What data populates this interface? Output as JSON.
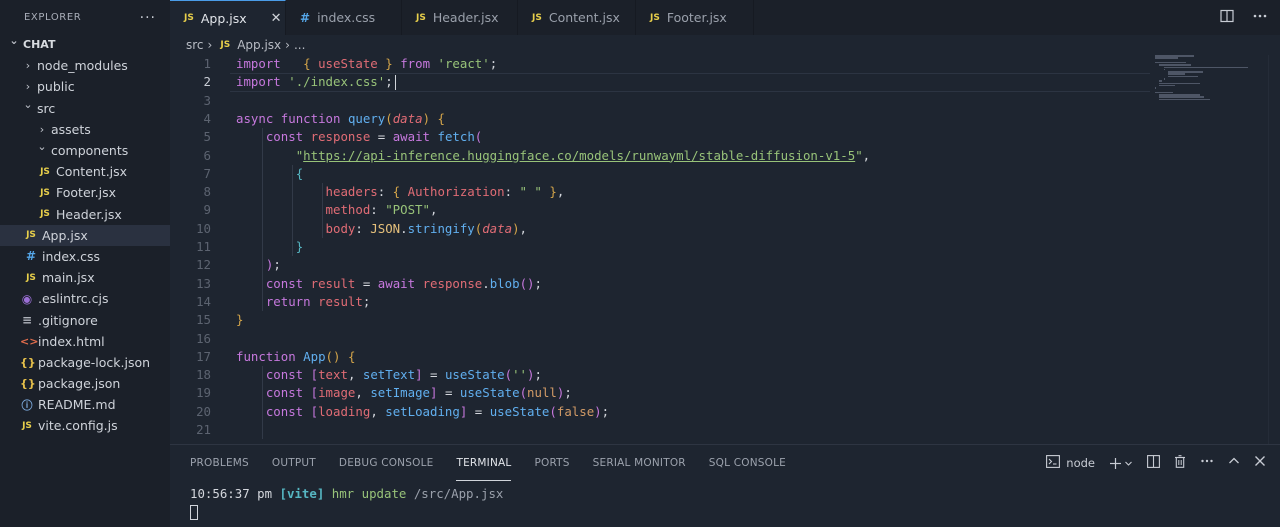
{
  "sidebar": {
    "title": "EXPLORER",
    "more": "···",
    "items": [
      {
        "label": "CHAT",
        "depth": 0,
        "icon": "chevron-down-icon",
        "kind": "root"
      },
      {
        "label": "node_modules",
        "depth": 1,
        "icon": "chevron-right-icon",
        "kind": "folder"
      },
      {
        "label": "public",
        "depth": 1,
        "icon": "chevron-right-icon",
        "kind": "folder"
      },
      {
        "label": "src",
        "depth": 1,
        "icon": "chevron-down-icon",
        "kind": "folder"
      },
      {
        "label": "assets",
        "depth": 2,
        "icon": "chevron-right-icon",
        "kind": "folder"
      },
      {
        "label": "components",
        "depth": 2,
        "icon": "chevron-down-icon",
        "kind": "folder"
      },
      {
        "label": "Content.jsx",
        "depth": 3,
        "icon": "js-file-icon",
        "kind": "js"
      },
      {
        "label": "Footer.jsx",
        "depth": 3,
        "icon": "js-file-icon",
        "kind": "js"
      },
      {
        "label": "Header.jsx",
        "depth": 3,
        "icon": "js-file-icon",
        "kind": "js"
      },
      {
        "label": "App.jsx",
        "depth": 2,
        "icon": "js-file-icon",
        "kind": "js",
        "active": true
      },
      {
        "label": "index.css",
        "depth": 2,
        "icon": "css-file-icon",
        "kind": "css"
      },
      {
        "label": "main.jsx",
        "depth": 2,
        "icon": "js-file-icon",
        "kind": "js"
      },
      {
        "label": ".eslintrc.cjs",
        "depth": 1,
        "icon": "eslint-file-icon",
        "kind": "eslint"
      },
      {
        "label": ".gitignore",
        "depth": 1,
        "icon": "gitignore-file-icon",
        "kind": "git"
      },
      {
        "label": "index.html",
        "depth": 1,
        "icon": "html-file-icon",
        "kind": "html"
      },
      {
        "label": "package-lock.json",
        "depth": 1,
        "icon": "json-file-icon",
        "kind": "json"
      },
      {
        "label": "package.json",
        "depth": 1,
        "icon": "json-file-icon",
        "kind": "json"
      },
      {
        "label": "README.md",
        "depth": 1,
        "icon": "info-file-icon",
        "kind": "info"
      },
      {
        "label": "vite.config.js",
        "depth": 1,
        "icon": "js-file-icon",
        "kind": "js"
      }
    ]
  },
  "tabs": [
    {
      "label": "App.jsx",
      "icon": "js-file-icon",
      "kind": "js",
      "active": true,
      "close": "✕"
    },
    {
      "label": "index.css",
      "icon": "css-file-icon",
      "kind": "css"
    },
    {
      "label": "Header.jsx",
      "icon": "js-file-icon",
      "kind": "js"
    },
    {
      "label": "Content.jsx",
      "icon": "js-file-icon",
      "kind": "js"
    },
    {
      "label": "Footer.jsx",
      "icon": "js-file-icon",
      "kind": "js"
    }
  ],
  "breadcrumb": {
    "folder": "src",
    "file": "App.jsx",
    "more": "..."
  },
  "icon_text": {
    "js": "JS",
    "css": "#",
    "sep": "›"
  },
  "editor": {
    "current_line": 2,
    "lines": [
      [
        [
          "kw",
          "import"
        ],
        [
          "pun",
          "   "
        ],
        [
          "br1",
          "{"
        ],
        [
          "pun",
          " "
        ],
        [
          "var",
          "useState"
        ],
        [
          "pun",
          " "
        ],
        [
          "br1",
          "}"
        ],
        [
          "pun",
          " "
        ],
        [
          "kw",
          "from"
        ],
        [
          "pun",
          " "
        ],
        [
          "str",
          "'react'"
        ],
        [
          "pun",
          ";"
        ]
      ],
      [
        [
          "kw",
          "import"
        ],
        [
          "pun",
          " "
        ],
        [
          "str",
          "'./index.css'"
        ],
        [
          "pun",
          ";"
        ]
      ],
      [],
      [
        [
          "kw",
          "async"
        ],
        [
          "pun",
          " "
        ],
        [
          "kw",
          "function"
        ],
        [
          "pun",
          " "
        ],
        [
          "fn",
          "query"
        ],
        [
          "br1",
          "("
        ],
        [
          "prm",
          "data"
        ],
        [
          "br1",
          ")"
        ],
        [
          "pun",
          " "
        ],
        [
          "br1",
          "{"
        ]
      ],
      [
        [
          "pun",
          "    "
        ],
        [
          "kw",
          "const"
        ],
        [
          "pun",
          " "
        ],
        [
          "var",
          "response"
        ],
        [
          "pun",
          " = "
        ],
        [
          "kw",
          "await"
        ],
        [
          "pun",
          " "
        ],
        [
          "fn",
          "fetch"
        ],
        [
          "br2",
          "("
        ]
      ],
      [
        [
          "pun",
          "        "
        ],
        [
          "str",
          "\""
        ],
        [
          "u",
          "https://api-inference.huggingface.co/models/runwayml/stable-diffusion-v1-5"
        ],
        [
          "str",
          "\""
        ],
        [
          "pun",
          ","
        ]
      ],
      [
        [
          "pun",
          "        "
        ],
        [
          "br3",
          "{"
        ]
      ],
      [
        [
          "pun",
          "            "
        ],
        [
          "var",
          "headers"
        ],
        [
          "pun",
          ": "
        ],
        [
          "br1",
          "{"
        ],
        [
          "pun",
          " "
        ],
        [
          "var",
          "Authorization"
        ],
        [
          "pun",
          ": "
        ],
        [
          "str",
          "\" \""
        ],
        [
          "pun",
          " "
        ],
        [
          "br1",
          "}"
        ],
        [
          "pun",
          ","
        ]
      ],
      [
        [
          "pun",
          "            "
        ],
        [
          "var",
          "method"
        ],
        [
          "pun",
          ": "
        ],
        [
          "str",
          "\"POST\""
        ],
        [
          "pun",
          ","
        ]
      ],
      [
        [
          "pun",
          "            "
        ],
        [
          "var",
          "body"
        ],
        [
          "pun",
          ": "
        ],
        [
          "obj",
          "JSON"
        ],
        [
          "pun",
          "."
        ],
        [
          "fn",
          "stringify"
        ],
        [
          "br1",
          "("
        ],
        [
          "prm",
          "data"
        ],
        [
          "br1",
          ")"
        ],
        [
          "pun",
          ","
        ]
      ],
      [
        [
          "pun",
          "        "
        ],
        [
          "br3",
          "}"
        ]
      ],
      [
        [
          "pun",
          "    "
        ],
        [
          "br2",
          ")"
        ],
        [
          "pun",
          ";"
        ]
      ],
      [
        [
          "pun",
          "    "
        ],
        [
          "kw",
          "const"
        ],
        [
          "pun",
          " "
        ],
        [
          "var",
          "result"
        ],
        [
          "pun",
          " = "
        ],
        [
          "kw",
          "await"
        ],
        [
          "pun",
          " "
        ],
        [
          "var",
          "response"
        ],
        [
          "pun",
          "."
        ],
        [
          "fn",
          "blob"
        ],
        [
          "br2",
          "()"
        ],
        [
          "pun",
          ";"
        ]
      ],
      [
        [
          "pun",
          "    "
        ],
        [
          "kw",
          "return"
        ],
        [
          "pun",
          " "
        ],
        [
          "var",
          "result"
        ],
        [
          "pun",
          ";"
        ]
      ],
      [
        [
          "br1",
          "}"
        ]
      ],
      [],
      [
        [
          "kw",
          "function"
        ],
        [
          "pun",
          " "
        ],
        [
          "fn",
          "App"
        ],
        [
          "br1",
          "()"
        ],
        [
          "pun",
          " "
        ],
        [
          "br1",
          "{"
        ]
      ],
      [
        [
          "pun",
          "    "
        ],
        [
          "kw",
          "const"
        ],
        [
          "pun",
          " "
        ],
        [
          "br2",
          "["
        ],
        [
          "var",
          "text"
        ],
        [
          "pun",
          ", "
        ],
        [
          "fn",
          "setText"
        ],
        [
          "br2",
          "]"
        ],
        [
          "pun",
          " = "
        ],
        [
          "fn",
          "useState"
        ],
        [
          "br2",
          "("
        ],
        [
          "str",
          "''"
        ],
        [
          "br2",
          ")"
        ],
        [
          "pun",
          ";"
        ]
      ],
      [
        [
          "pun",
          "    "
        ],
        [
          "kw",
          "const"
        ],
        [
          "pun",
          " "
        ],
        [
          "br2",
          "["
        ],
        [
          "var",
          "image"
        ],
        [
          "pun",
          ", "
        ],
        [
          "fn",
          "setImage"
        ],
        [
          "br2",
          "]"
        ],
        [
          "pun",
          " = "
        ],
        [
          "fn",
          "useState"
        ],
        [
          "br2",
          "("
        ],
        [
          "lit",
          "null"
        ],
        [
          "br2",
          ")"
        ],
        [
          "pun",
          ";"
        ]
      ],
      [
        [
          "pun",
          "    "
        ],
        [
          "kw",
          "const"
        ],
        [
          "pun",
          " "
        ],
        [
          "br2",
          "["
        ],
        [
          "var",
          "loading"
        ],
        [
          "pun",
          ", "
        ],
        [
          "fn",
          "setLoading"
        ],
        [
          "br2",
          "]"
        ],
        [
          "pun",
          " = "
        ],
        [
          "fn",
          "useState"
        ],
        [
          "br2",
          "("
        ],
        [
          "lit",
          "false"
        ],
        [
          "br2",
          ")"
        ],
        [
          "pun",
          ";"
        ]
      ],
      []
    ]
  },
  "panel": {
    "tabs": [
      {
        "label": "PROBLEMS"
      },
      {
        "label": "OUTPUT"
      },
      {
        "label": "DEBUG CONSOLE"
      },
      {
        "label": "TERMINAL",
        "active": true
      },
      {
        "label": "PORTS"
      },
      {
        "label": "SERIAL MONITOR"
      },
      {
        "label": "SQL CONSOLE"
      }
    ],
    "terminal_name": "node",
    "terminal_line": {
      "time": "10:56:37 pm",
      "tag": "[vite]",
      "msg": "hmr update",
      "path": "/src/App.jsx"
    }
  }
}
